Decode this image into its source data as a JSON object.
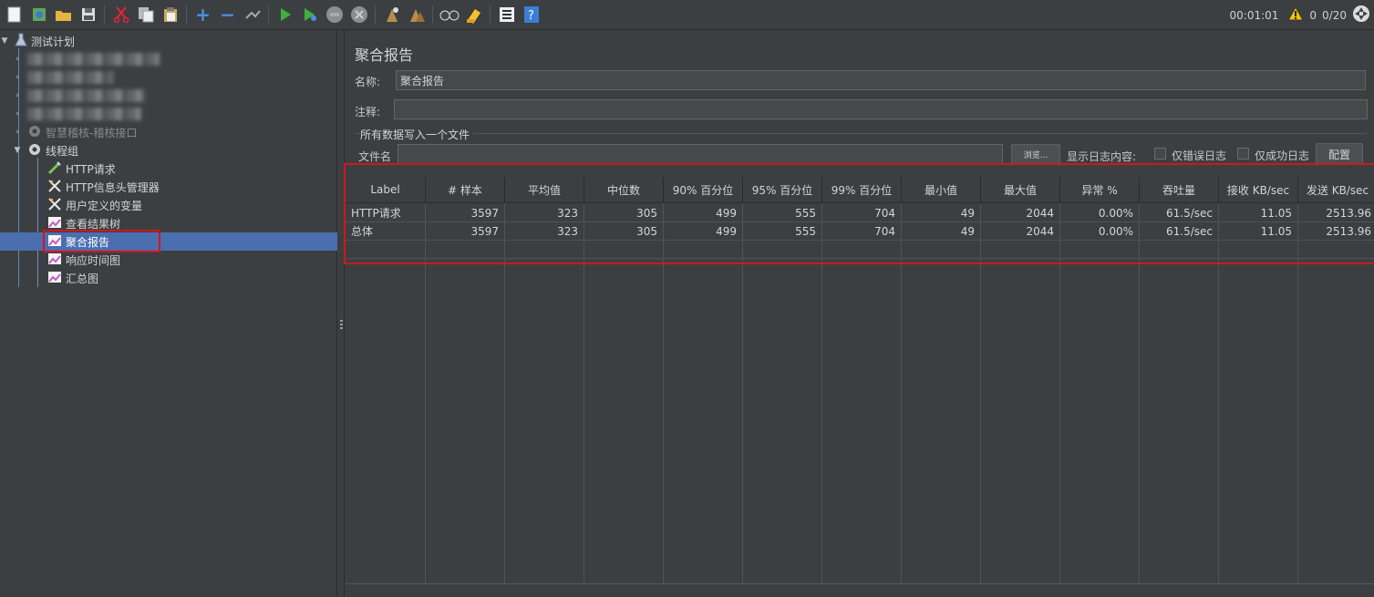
{
  "toolbar": {
    "icons": [
      "new-icon",
      "templates-icon",
      "open-icon",
      "save-icon",
      "cut-icon",
      "copy-icon",
      "paste-icon",
      "expand-icon",
      "collapse-icon",
      "toggle-icon",
      "start-icon",
      "start-no-pause-icon",
      "stop-icon",
      "shutdown-icon",
      "clear-icon",
      "clear-all-icon",
      "search-icon",
      "reset-search-icon",
      "function-helper-icon",
      "help-icon"
    ],
    "elapsed": "00:01:01",
    "warnings": "0",
    "threads": "0/20"
  },
  "tree": {
    "root": "测试计划",
    "disabled_group": "智慧稽核-稽核接口",
    "thread_group": "线程组",
    "items": [
      "HTTP请求",
      "HTTP信息头管理器",
      "用户定义的变量",
      "查看结果树",
      "聚合报告",
      "响应时间图",
      "汇总图"
    ]
  },
  "panel": {
    "title": "聚合报告",
    "name_label": "名称:",
    "name_value": "聚合报告",
    "comment_label": "注释:",
    "comment_value": "",
    "file_group_title": "所有数据写入一个文件",
    "filename_label": "文件名",
    "filename_value": "",
    "browse_label": "浏览...",
    "log_display_label": "显示日志内容:",
    "errors_only_label": "仅错误日志",
    "success_only_label": "仅成功日志",
    "configure_label": "配置"
  },
  "table": {
    "headers": [
      "Label",
      "# 样本",
      "平均值",
      "中位数",
      "90% 百分位",
      "95% 百分位",
      "99% 百分位",
      "最小值",
      "最大值",
      "异常 %",
      "吞吐量",
      "接收 KB/sec",
      "发送 KB/sec"
    ],
    "rows": [
      [
        "HTTP请求",
        "3597",
        "323",
        "305",
        "499",
        "555",
        "704",
        "49",
        "2044",
        "0.00%",
        "61.5/sec",
        "11.05",
        "2513.96"
      ],
      [
        "总体",
        "3597",
        "323",
        "305",
        "499",
        "555",
        "704",
        "49",
        "2044",
        "0.00%",
        "61.5/sec",
        "11.05",
        "2513.96"
      ]
    ]
  },
  "colors": {
    "background": "#3c3f41",
    "selected": "#4b6eaf",
    "highlight_box": "#d0161e"
  }
}
